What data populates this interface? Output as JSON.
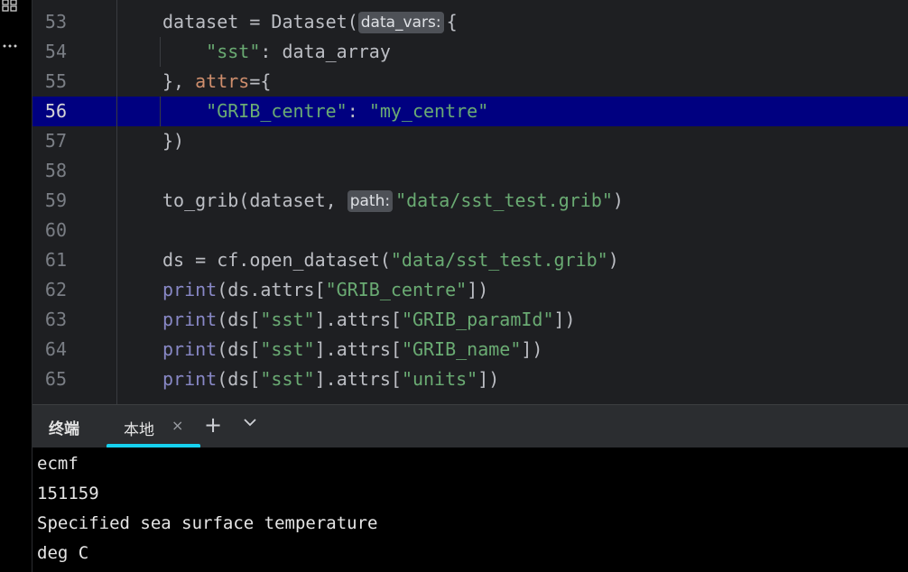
{
  "editor": {
    "active_line": "56",
    "lines": [
      {
        "num": "53",
        "parts": [
          {
            "t": "dataset = Dataset(",
            "c": "plain"
          },
          {
            "t": "data_vars:",
            "c": "hint"
          },
          {
            "t": "{",
            "c": "plain"
          }
        ]
      },
      {
        "num": "54",
        "parts": [
          {
            "t": "    ",
            "c": "plain"
          },
          {
            "t": "\"sst\"",
            "c": "str"
          },
          {
            "t": ": data_array",
            "c": "plain"
          }
        ]
      },
      {
        "num": "55",
        "parts": [
          {
            "t": "}, ",
            "c": "plain"
          },
          {
            "t": "attrs",
            "c": "kw"
          },
          {
            "t": "={",
            "c": "plain"
          }
        ]
      },
      {
        "num": "56",
        "parts": [
          {
            "t": "    ",
            "c": "plain"
          },
          {
            "t": "\"GRIB_centre\"",
            "c": "str"
          },
          {
            "t": ": ",
            "c": "plain"
          },
          {
            "t": "\"my_centre\"",
            "c": "str"
          }
        ]
      },
      {
        "num": "57",
        "parts": [
          {
            "t": "})",
            "c": "plain"
          }
        ]
      },
      {
        "num": "58",
        "parts": []
      },
      {
        "num": "59",
        "parts": [
          {
            "t": "to_grib(dataset, ",
            "c": "plain"
          },
          {
            "t": "path:",
            "c": "hint"
          },
          {
            "t": "\"data/sst_test.grib\"",
            "c": "str"
          },
          {
            "t": ")",
            "c": "plain"
          }
        ]
      },
      {
        "num": "60",
        "parts": []
      },
      {
        "num": "61",
        "parts": [
          {
            "t": "ds = cf.open_dataset(",
            "c": "plain"
          },
          {
            "t": "\"data/sst_test.grib\"",
            "c": "str"
          },
          {
            "t": ")",
            "c": "plain"
          }
        ]
      },
      {
        "num": "62",
        "parts": [
          {
            "t": "print",
            "c": "fn"
          },
          {
            "t": "(ds.attrs[",
            "c": "plain"
          },
          {
            "t": "\"GRIB_centre\"",
            "c": "str"
          },
          {
            "t": "])",
            "c": "plain"
          }
        ]
      },
      {
        "num": "63",
        "parts": [
          {
            "t": "print",
            "c": "fn"
          },
          {
            "t": "(ds[",
            "c": "plain"
          },
          {
            "t": "\"sst\"",
            "c": "str"
          },
          {
            "t": "].attrs[",
            "c": "plain"
          },
          {
            "t": "\"GRIB_paramId\"",
            "c": "str"
          },
          {
            "t": "])",
            "c": "plain"
          }
        ]
      },
      {
        "num": "64",
        "parts": [
          {
            "t": "print",
            "c": "fn"
          },
          {
            "t": "(ds[",
            "c": "plain"
          },
          {
            "t": "\"sst\"",
            "c": "str"
          },
          {
            "t": "].attrs[",
            "c": "plain"
          },
          {
            "t": "\"GRIB_name\"",
            "c": "str"
          },
          {
            "t": "])",
            "c": "plain"
          }
        ]
      },
      {
        "num": "65",
        "parts": [
          {
            "t": "print",
            "c": "fn"
          },
          {
            "t": "(ds[",
            "c": "plain"
          },
          {
            "t": "\"sst\"",
            "c": "str"
          },
          {
            "t": "].attrs[",
            "c": "plain"
          },
          {
            "t": "\"units\"",
            "c": "str"
          },
          {
            "t": "])",
            "c": "plain"
          }
        ]
      }
    ]
  },
  "panel": {
    "title": "终端",
    "tab_label": "本地",
    "tab_close": "×",
    "add": "+",
    "dropdown": "⌄"
  },
  "terminal": {
    "lines": [
      "ecmf",
      "151159",
      "Specified sea surface temperature",
      "deg C"
    ]
  },
  "leftbar": {
    "structure_icon": "structure-icon",
    "more_icon": "more-icon"
  },
  "colors": {
    "active_line_bg": "#000080",
    "string": "#6aab73",
    "keyword": "#cf8e6d",
    "builtin": "#8888c6",
    "tab_accent": "#17d2f0"
  }
}
